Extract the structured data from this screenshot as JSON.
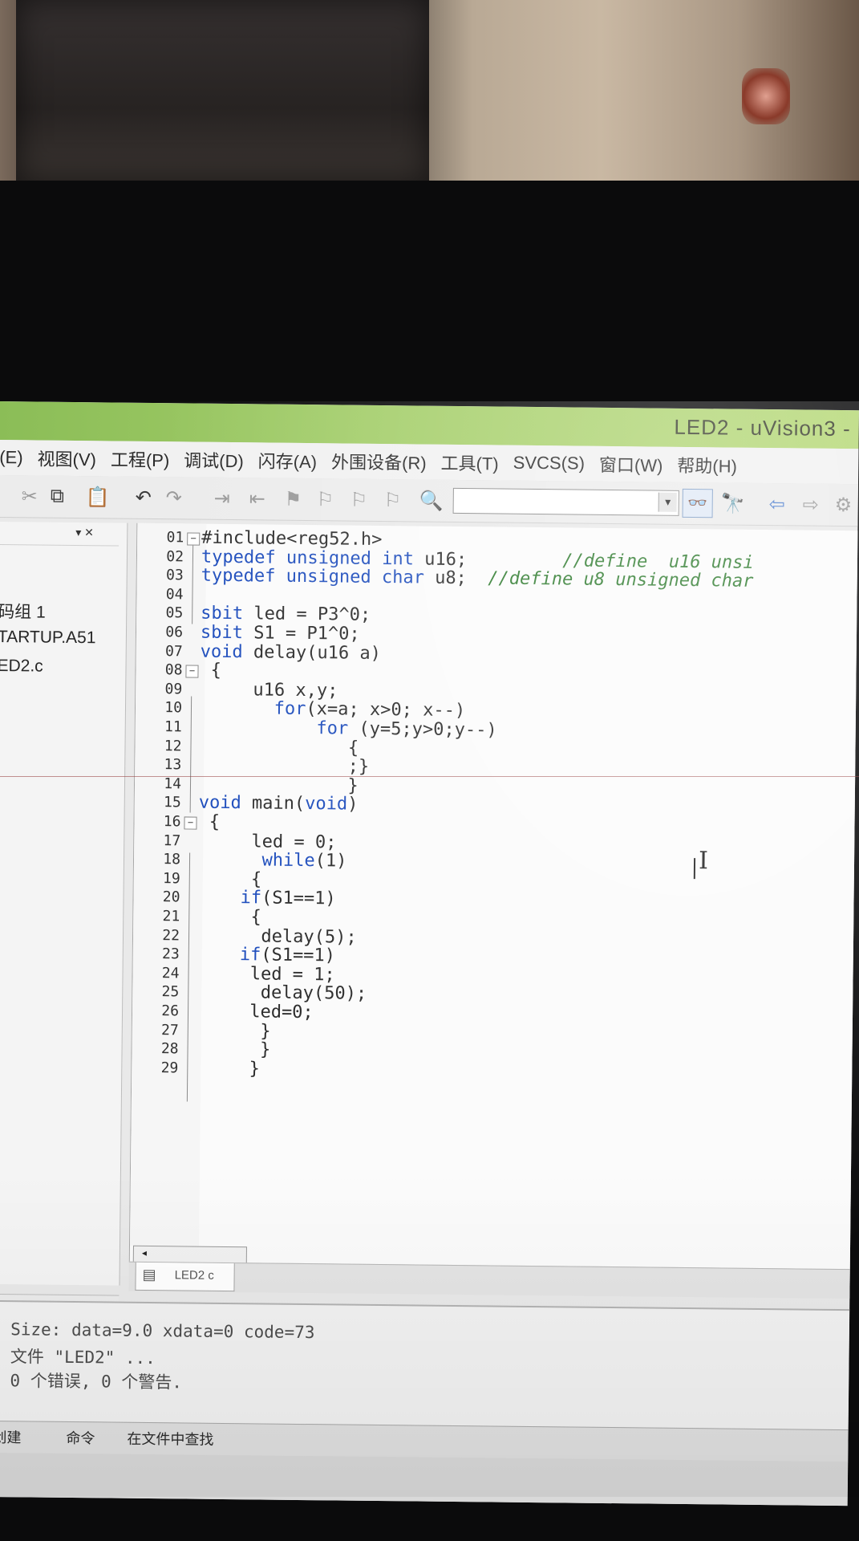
{
  "window": {
    "title": "LED2  - uVision3 -"
  },
  "menu": [
    "(E)",
    "视图(V)",
    "工程(P)",
    "调试(D)",
    "闪存(A)",
    "外围设备(R)",
    "工具(T)",
    "SVCS(S)",
    "窗口(W)",
    "帮助(H)"
  ],
  "project_panel": {
    "close_label": "▾ ✕",
    "items": [
      "码组 1",
      "TARTUP.A51",
      "ED2.c"
    ]
  },
  "editor": {
    "lines": [
      {
        "no": "01",
        "code": "#include<reg52.h>"
      },
      {
        "no": "02",
        "code": "typedef unsigned int u16;         //define  u16 unsi"
      },
      {
        "no": "03",
        "code": "typedef unsigned char u8;  //define u8 unsigned char"
      },
      {
        "no": "04",
        "code": ""
      },
      {
        "no": "05",
        "code": "sbit led = P3^0;"
      },
      {
        "no": "06",
        "code": "sbit S1 = P1^0;"
      },
      {
        "no": "07",
        "code": "void delay(u16 a)"
      },
      {
        "no": "08",
        "code": " {"
      },
      {
        "no": "09",
        "code": "     u16 x,y;"
      },
      {
        "no": "10",
        "code": "       for(x=a; x>0; x--)"
      },
      {
        "no": "11",
        "code": "           for (y=5;y>0;y--)"
      },
      {
        "no": "12",
        "code": "              {"
      },
      {
        "no": "13",
        "code": "              ;}"
      },
      {
        "no": "14",
        "code": "              }"
      },
      {
        "no": "15",
        "code": "void main(void)"
      },
      {
        "no": "16",
        "code": " {"
      },
      {
        "no": "17",
        "code": "     led = 0;"
      },
      {
        "no": "18",
        "code": "      while(1)"
      },
      {
        "no": "19",
        "code": "     {"
      },
      {
        "no": "20",
        "code": "    if(S1==1)"
      },
      {
        "no": "21",
        "code": "     {"
      },
      {
        "no": "22",
        "code": "      delay(5);"
      },
      {
        "no": "23",
        "code": "    if(S1==1)"
      },
      {
        "no": "24",
        "code": "     led = 1;"
      },
      {
        "no": "25",
        "code": "      delay(50);"
      },
      {
        "no": "26",
        "code": "     led=0;"
      },
      {
        "no": "27",
        "code": "      }"
      },
      {
        "no": "28",
        "code": "      }"
      },
      {
        "no": "29",
        "code": "     }"
      }
    ],
    "tab_label": "LED2 c"
  },
  "output": {
    "lines": [
      ". Size: data=9.0 xdata=0 code=73",
      "X 文件 \"LED2\" ...",
      "- 0 个错误, 0 个警告."
    ]
  },
  "output_tabs": [
    "创建",
    "命令",
    "在文件中查找"
  ]
}
